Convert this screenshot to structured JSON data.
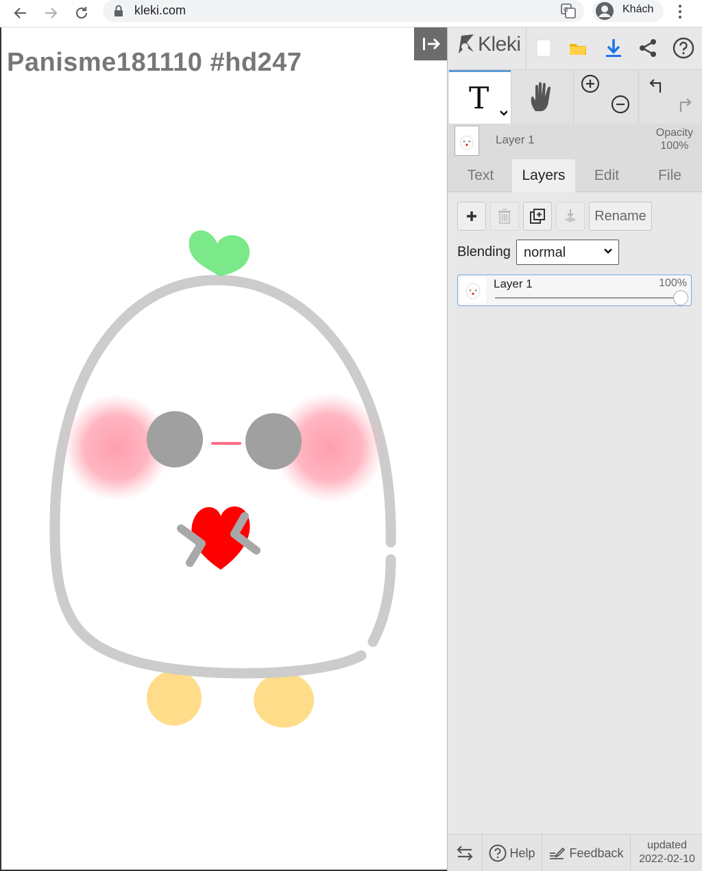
{
  "browser": {
    "url": "kleki.com",
    "profile_name": "Khách"
  },
  "canvas": {
    "title": "Panisme181110 #hd247"
  },
  "topbar": {
    "logo_text": "Kleki",
    "icons": [
      "new-image-icon",
      "open-folder-icon",
      "download-icon",
      "share-icon",
      "help-icon"
    ]
  },
  "tools": {
    "active": "text",
    "items": [
      "text-tool",
      "hand-tool",
      "zoom-in",
      "zoom-out",
      "undo",
      "redo"
    ]
  },
  "current_layer": {
    "name": "Layer 1",
    "opacity_label": "Opacity",
    "opacity_value": "100%"
  },
  "tabs": [
    {
      "label": "Text",
      "active": false
    },
    {
      "label": "Layers",
      "active": true
    },
    {
      "label": "Edit",
      "active": false
    },
    {
      "label": "File",
      "active": false
    }
  ],
  "layers_panel": {
    "rename_label": "Rename",
    "blending_label": "Blending",
    "blending_value": "normal",
    "layers": [
      {
        "name": "Layer 1",
        "opacity": "100%",
        "opacity_fraction": 1.0
      }
    ]
  },
  "footer": {
    "help_label": "Help",
    "feedback_label": "Feedback",
    "updated_label": "updated",
    "updated_date": "2022-02-10"
  },
  "colors": {
    "accent": "#5b9bd5",
    "download_blue": "#1a73e8",
    "folder_yellow": "#f5b800",
    "cheek_pink": "#ff9aab",
    "heart_red": "#ff0000",
    "sprout_green": "#7be88a",
    "feet_yellow": "#ffdc8a",
    "outline_gray": "#cccccc",
    "eye_gray": "#a0a0a0"
  }
}
